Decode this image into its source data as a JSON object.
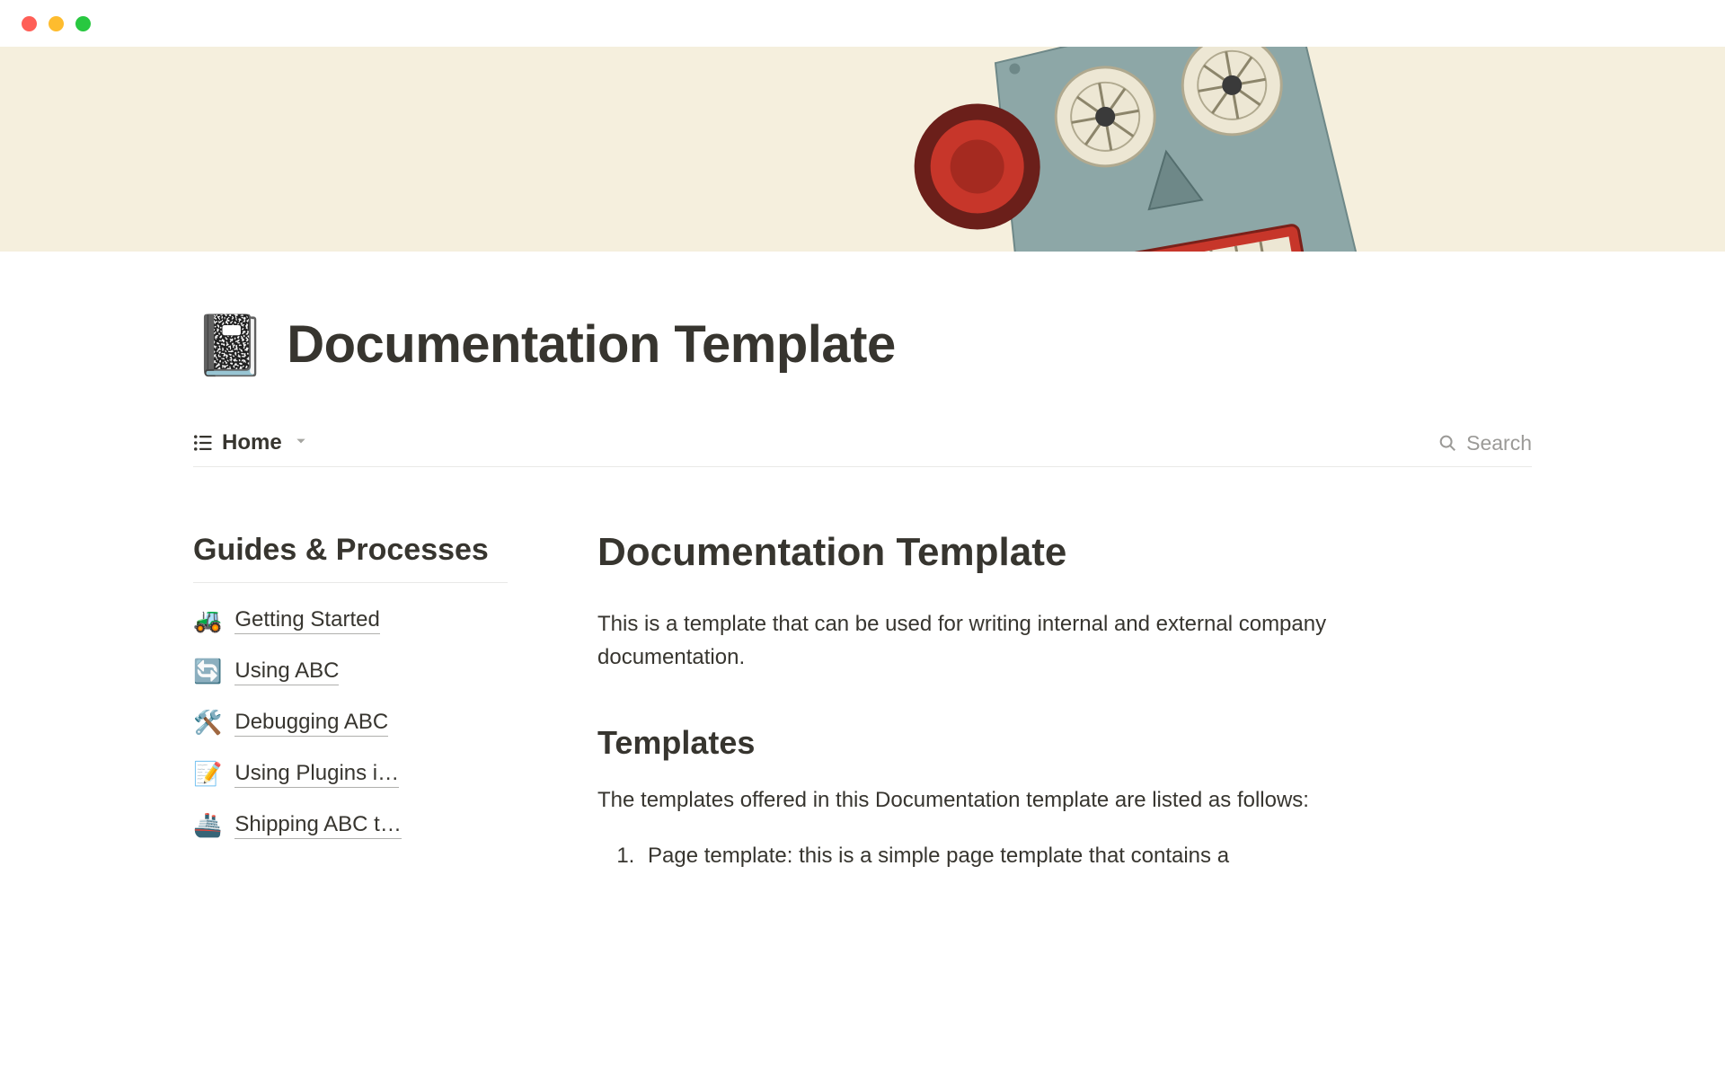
{
  "page": {
    "icon": "📓",
    "title": "Documentation Template"
  },
  "viewbar": {
    "view_name": "Home",
    "search_label": "Search"
  },
  "sidebar": {
    "heading": "Guides & Processes",
    "items": [
      {
        "emoji": "🚜",
        "label": "Getting Started"
      },
      {
        "emoji": "🔄",
        "label": "Using ABC"
      },
      {
        "emoji": "🛠️",
        "label": "Debugging ABC"
      },
      {
        "emoji": "📝",
        "label": "Using Plugins i…"
      },
      {
        "emoji": "🚢",
        "label": "Shipping ABC t…"
      }
    ]
  },
  "main": {
    "title": "Documentation Template",
    "intro": "This is a template that can be used for writing internal and external company documentation.",
    "section_heading": "Templates",
    "section_body": "The templates offered in this Documentation template are listed as follows:",
    "list_item_1": "Page template: this is a simple page template that contains a"
  }
}
